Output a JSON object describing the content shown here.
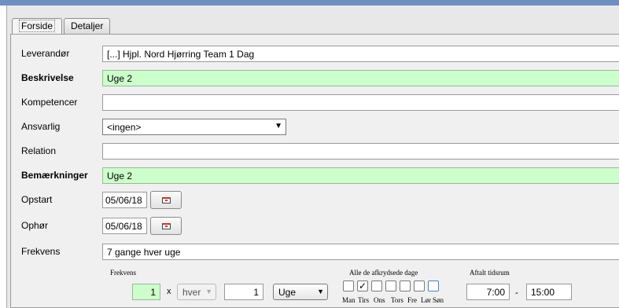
{
  "tabs": [
    "Forside",
    "Detaljer"
  ],
  "form": {
    "leverandor": {
      "label": "Leverandør",
      "value": "[...] Hjpl. Nord Hjørring Team 1 Dag"
    },
    "beskrivelse": {
      "label": "Beskrivelse",
      "value": "Uge 2"
    },
    "kompetencer": {
      "label": "Kompetencer",
      "value": ""
    },
    "ansvarlig": {
      "label": "Ansvarlig",
      "value": "<ingen>"
    },
    "relation": {
      "label": "Relation",
      "value": ""
    },
    "bemaerkninger": {
      "label": "Bemærkninger",
      "value": "Uge 2"
    },
    "opstart": {
      "label": "Opstart",
      "value": "05/06/18"
    },
    "ophor": {
      "label": "Ophør",
      "value": "05/06/18"
    },
    "frekvens": {
      "label": "Frekvens",
      "value": "7 gange hver uge"
    }
  },
  "frequency": {
    "heading": "Frekvens",
    "count": "1",
    "x": "x",
    "every": "hver",
    "interval": "1",
    "unit": "Uge",
    "days_heading": "Alle de afkrydsede dage",
    "days": [
      {
        "label": "Man",
        "checked": false
      },
      {
        "label": "Tirs",
        "checked": true
      },
      {
        "label": "Ons",
        "checked": false
      },
      {
        "label": "Tors",
        "checked": false
      },
      {
        "label": "Fre",
        "checked": false
      },
      {
        "label": "Lør",
        "checked": false
      },
      {
        "label": "Søn",
        "checked": false
      }
    ],
    "time_heading": "Aftalt tidsrum",
    "time_from": "7:00",
    "dash": "-",
    "time_to": "15:00"
  }
}
